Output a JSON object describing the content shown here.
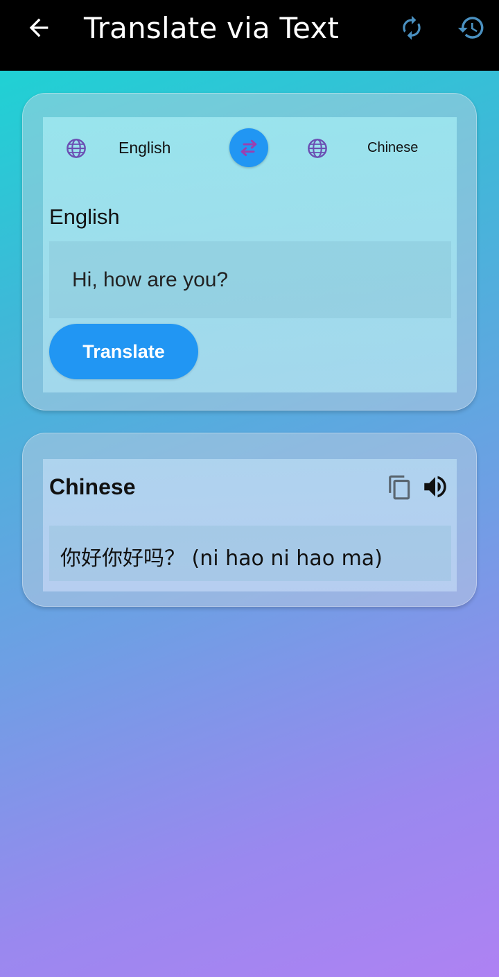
{
  "header": {
    "title": "Translate via Text",
    "back_icon": "arrow-back-icon",
    "refresh_icon": "refresh-icon",
    "history_icon": "history-icon"
  },
  "language_selector": {
    "source_language": "English",
    "target_language": "Chinese",
    "globe_icon": "globe-icon",
    "swap_icon": "swap-arrows-icon"
  },
  "input_section": {
    "language_heading": "English",
    "text_value": "Hi, how are you?",
    "translate_label": "Translate"
  },
  "output_section": {
    "language_heading": "Chinese",
    "translated_text": "你好你好吗？ (ni hao ni hao ma)",
    "copy_icon": "copy-icon",
    "speaker_icon": "speaker-icon"
  },
  "colors": {
    "accent": "#2196f3",
    "header_background": "#000000",
    "icon_accent": "#4a90c0",
    "globe_color": "#6b4fb3",
    "swap_arrow_color": "#9b3fb0"
  }
}
